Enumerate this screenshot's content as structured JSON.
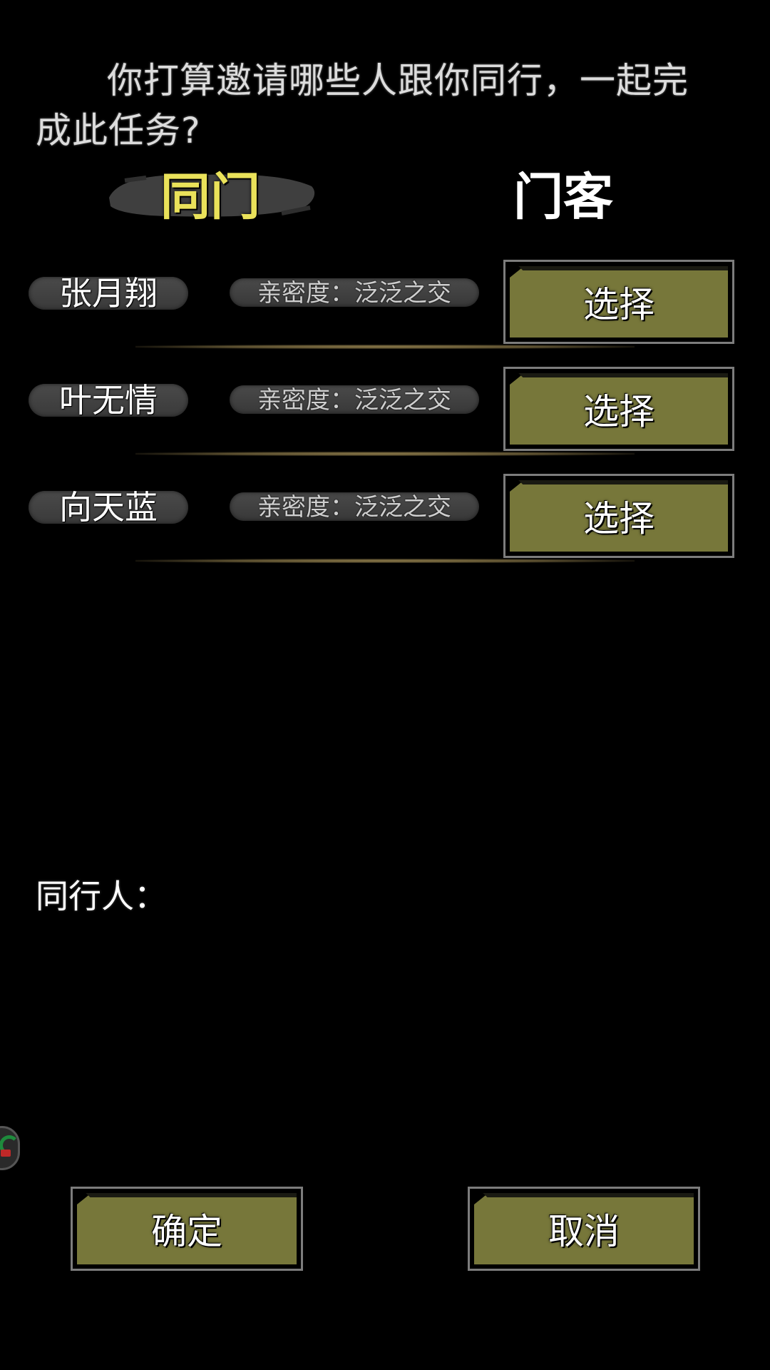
{
  "prompt": "你打算邀请哪些人跟你同行，一起完成此任务?",
  "tabs": {
    "active": "同门",
    "inactive": "门客"
  },
  "candidates": [
    {
      "name": "张月翔",
      "intimacy": "亲密度：泛泛之交",
      "button": "选择"
    },
    {
      "name": "叶无情",
      "intimacy": "亲密度：泛泛之交",
      "button": "选择"
    },
    {
      "name": "向天蓝",
      "intimacy": "亲密度：泛泛之交",
      "button": "选择"
    }
  ],
  "companions_label": "同行人：",
  "actions": {
    "confirm": "确定",
    "cancel": "取消"
  },
  "colors": {
    "background": "#000000",
    "button_fill": "#77773a",
    "active_tab_text": "#eae25a",
    "divider": "#8c7a4a"
  },
  "icons": {
    "floating": "floating-assistant-icon"
  }
}
